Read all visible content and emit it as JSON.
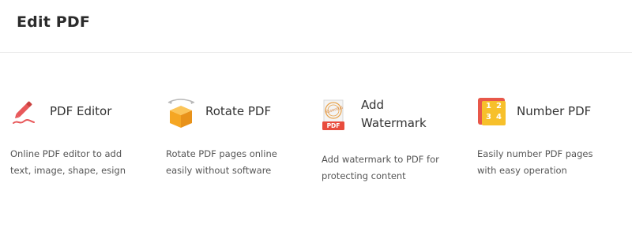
{
  "header": {
    "title": "Edit PDF"
  },
  "tools": [
    {
      "icon": "pen-icon",
      "title_lines": [
        "PDF Editor"
      ],
      "desc_lines": [
        "Online PDF editor to add",
        "text, image, shape, esign"
      ]
    },
    {
      "icon": "rotate-cube-icon",
      "title_lines": [
        "Rotate PDF"
      ],
      "desc_lines": [
        "Rotate PDF pages online",
        "easily without software"
      ]
    },
    {
      "icon": "watermark-stamp-icon",
      "icon_badge": "PDF",
      "icon_stamp_text": "Essential",
      "title_lines": [
        "Add",
        "Watermark"
      ],
      "desc_lines": [
        "Add watermark to PDF for",
        "protecting content"
      ]
    },
    {
      "icon": "number-grid-icon",
      "icon_digits": [
        "1",
        "2",
        "3",
        "4"
      ],
      "title_lines": [
        "Number PDF"
      ],
      "desc_lines": [
        "Easily number PDF pages",
        "with easy operation"
      ]
    }
  ],
  "colors": {
    "pen_red": "#e8585a",
    "cube_orange": "#f5a623",
    "number_red": "#e8584a",
    "number_yellow": "#f7c02b",
    "badge_red": "#e84c3d"
  }
}
